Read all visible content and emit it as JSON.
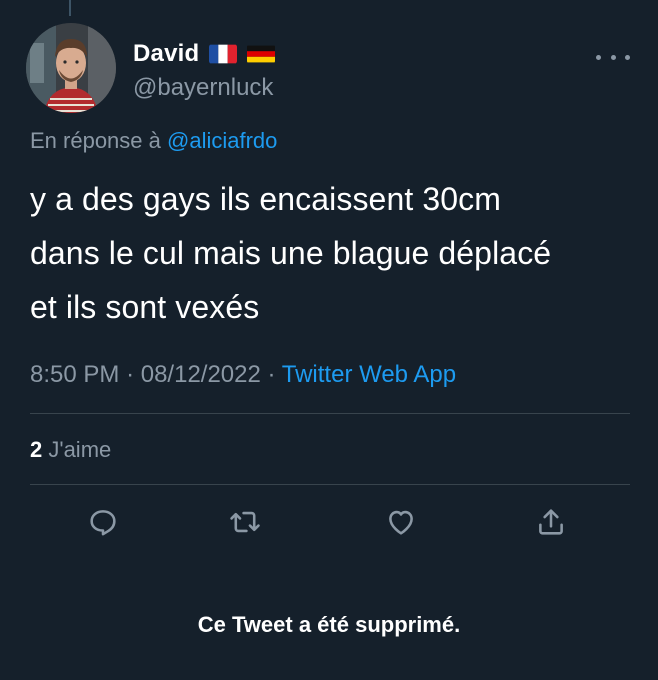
{
  "tweet": {
    "author": {
      "display_name": "David",
      "flags": [
        "france-flag-icon",
        "germany-flag-icon"
      ],
      "handle": "@bayernluck"
    },
    "reply": {
      "prefix": "En réponse à",
      "mention": "@aliciafrdo"
    },
    "text_lines": [
      "y a des gays ils encaissent 30cm",
      "dans le cul mais une blague déplacé",
      "et ils sont vexés"
    ],
    "meta": {
      "time": "8:50 PM",
      "separator": "·",
      "date": "08/12/2022",
      "source": "Twitter Web App"
    },
    "likes": {
      "count": "2",
      "label": "J'aime"
    },
    "actions": [
      "reply-icon",
      "retweet-icon",
      "like-icon",
      "share-icon"
    ],
    "deleted_notice": "Ce Tweet a été supprimé."
  },
  "colors": {
    "background": "#15202b",
    "accent": "#1d9bf0",
    "muted": "#8b98a5",
    "divider": "#38444d"
  }
}
